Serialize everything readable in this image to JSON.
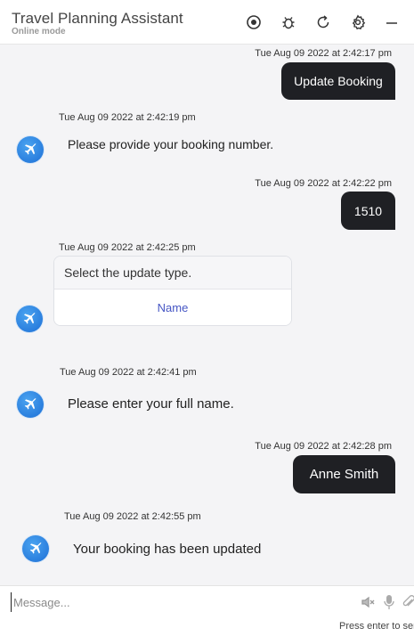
{
  "header": {
    "title": "Travel Planning Assistant",
    "subtitle": "Online mode",
    "icons": [
      "record-icon",
      "bug-icon",
      "refresh-icon",
      "settings-icon",
      "minimize-icon"
    ]
  },
  "messages": [
    {
      "from": "user",
      "time": "Tue Aug 09 2022 at 2:42:17 pm",
      "text": "Update Booking"
    },
    {
      "from": "bot",
      "time": "Tue Aug 09 2022 at 2:42:19 pm",
      "text": "Please provide your booking number."
    },
    {
      "from": "user",
      "time": "Tue Aug 09 2022 at 2:42:22 pm",
      "text": "1510"
    },
    {
      "from": "bot",
      "time": "Tue Aug 09 2022 at 2:42:25 pm",
      "text": "Select the update type.",
      "option": "Name"
    },
    {
      "from": "bot",
      "time": "Tue Aug 09 2022 at 2:42:41 pm",
      "text": "Please enter your full name."
    },
    {
      "from": "user",
      "time": "Tue  Aug 09 2022 at 2:42:28 pm",
      "text": "Anne Smith"
    },
    {
      "from": "bot",
      "time": "Tue Aug 09 2022 at 2:42:55 pm",
      "text": "Your booking has been updated"
    }
  ],
  "composer": {
    "placeholder": "Message...",
    "hint": "Press enter to send",
    "icons": [
      "speaker-muted-icon",
      "microphone-icon",
      "attachment-icon"
    ]
  }
}
